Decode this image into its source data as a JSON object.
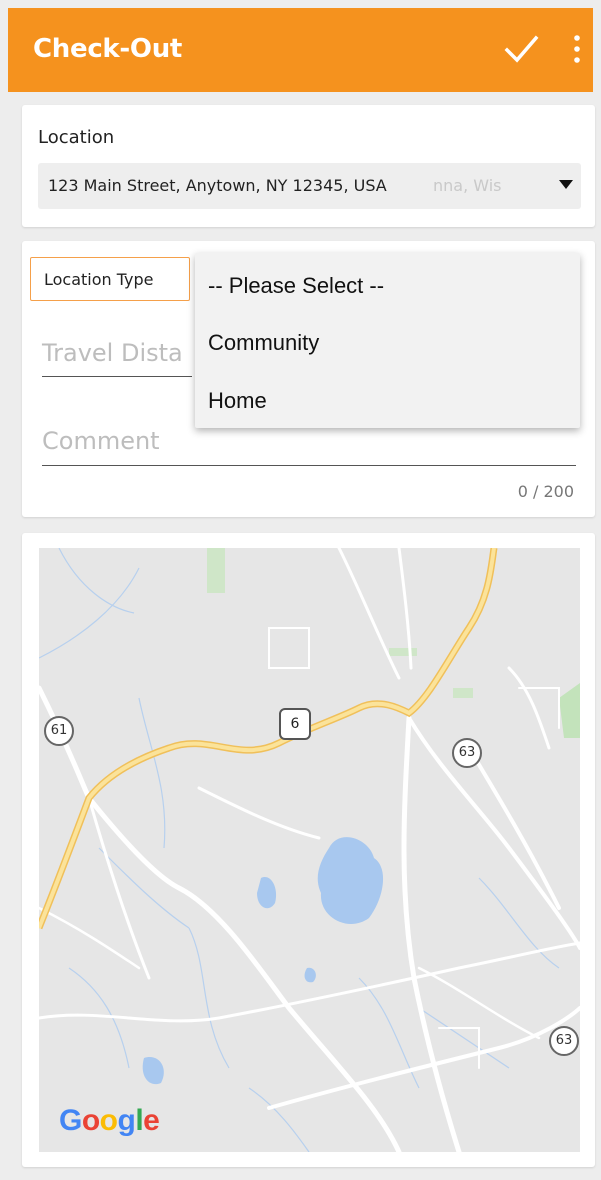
{
  "appbar": {
    "title": "Check-Out",
    "confirm_icon": "check-icon",
    "more_icon": "more-vert-icon",
    "color": "#f5921e"
  },
  "location": {
    "label": "Location",
    "value": "123 Main Street, Anytown, NY 12345, USA",
    "ghost_text": "nna, Wis"
  },
  "location_type": {
    "label": "Location Type",
    "options": [
      "-- Please Select --",
      "Community",
      "Home"
    ]
  },
  "travel_distance": {
    "placeholder": "Travel Dista"
  },
  "comment": {
    "placeholder": "Comment",
    "counter": "0 / 200"
  },
  "map": {
    "route_labels": [
      "61",
      "6",
      "63",
      "63"
    ],
    "attribution": [
      "G",
      "o",
      "o",
      "g",
      "l",
      "e"
    ]
  }
}
